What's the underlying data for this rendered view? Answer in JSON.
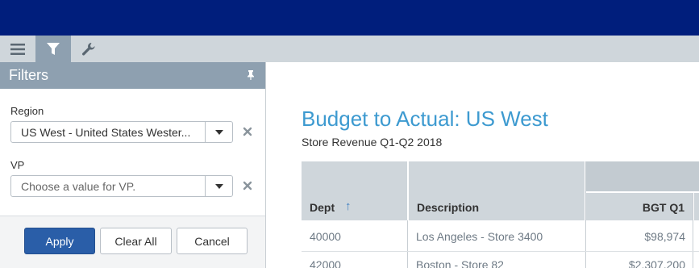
{
  "toolbar": {
    "buttons": [
      {
        "name": "menu",
        "icon": "hamburger-icon"
      },
      {
        "name": "filter",
        "icon": "filter-icon",
        "active": true
      },
      {
        "name": "settings",
        "icon": "wrench-icon"
      }
    ]
  },
  "filters": {
    "title": "Filters",
    "pin_icon": "pin-icon",
    "region": {
      "label": "Region",
      "value": "US West - United States Wester...",
      "clear_icon": "close-icon"
    },
    "vp": {
      "label": "VP",
      "placeholder": "Choose a value for VP.",
      "clear_icon": "close-icon"
    },
    "actions": {
      "apply": "Apply",
      "clear_all": "Clear All",
      "cancel": "Cancel"
    }
  },
  "report": {
    "title": "Budget to Actual: US West",
    "subtitle": "Store Revenue Q1-Q2 2018",
    "columns": {
      "dept": "Dept",
      "sort_icon": "↑",
      "description": "Description",
      "bgt_q1": "BGT Q1"
    },
    "rows": [
      {
        "dept": "40000",
        "description": "Los Angeles - Store 3400",
        "bgt_q1": "$98,974"
      },
      {
        "dept": "42000",
        "description": "Boston - Store 82",
        "bgt_q1": "$2,307,200"
      }
    ]
  },
  "colors": {
    "topbar": "#001e7c",
    "accent": "#3d9ad0",
    "primary_button": "#2a5ea8",
    "panel_header": "#8ea0b0"
  }
}
